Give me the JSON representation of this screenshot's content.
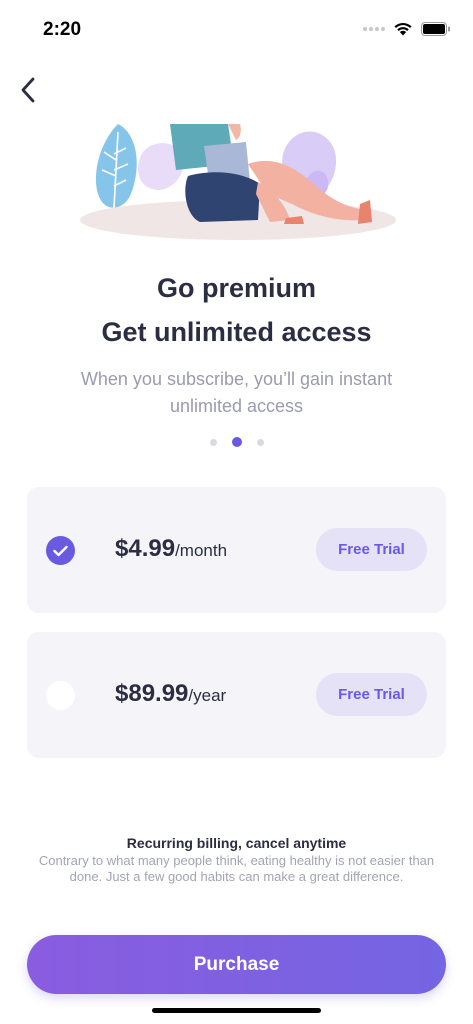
{
  "status_bar": {
    "time": "2:20"
  },
  "header": {
    "back_icon": "chevron-left-icon"
  },
  "hero": {
    "illustration": "person-with-laptop-illustration"
  },
  "title_line1": "Go premium",
  "title_line2": "Get unlimited access",
  "subtitle": "When you subscribe, you’ll gain instant unlimited access",
  "pagination": {
    "total": 3,
    "active_index": 1
  },
  "plans": [
    {
      "price": "$4.99",
      "period": "/month",
      "trial_label": "Free Trial",
      "selected": true
    },
    {
      "price": "$89.99",
      "period": "/year",
      "trial_label": "Free Trial",
      "selected": false
    }
  ],
  "billing": {
    "title": "Recurring billing, cancel anytime",
    "text": "Contrary to what many people think, eating healthy is not easier than done. Just a few good habits can make a great difference."
  },
  "purchase_label": "Purchase",
  "colors": {
    "accent": "#6a5ae0",
    "card_bg": "#f4f4f9",
    "trial_bg": "#e5e1f7"
  }
}
